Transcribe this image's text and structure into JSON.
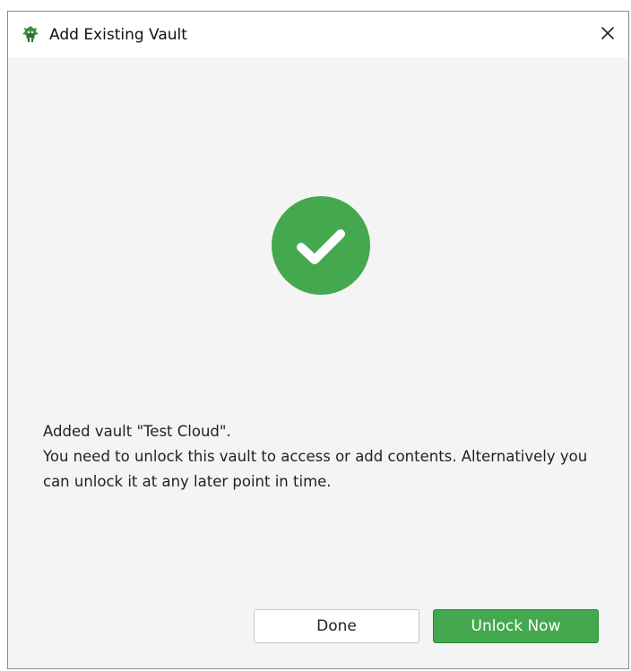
{
  "dialog": {
    "title": "Add Existing Vault",
    "app_icon": "cryptomator-bot-icon",
    "close_icon": "close-icon"
  },
  "status": {
    "icon": "check-circle-icon",
    "accent_color": "#44a84e"
  },
  "message": {
    "line1": "Added vault \"Test Cloud\".",
    "line2": "You need to unlock this vault to access or add contents. Alternatively you can unlock it at any later point in time."
  },
  "buttons": {
    "done_label": "Done",
    "unlock_label": "Unlock Now"
  }
}
